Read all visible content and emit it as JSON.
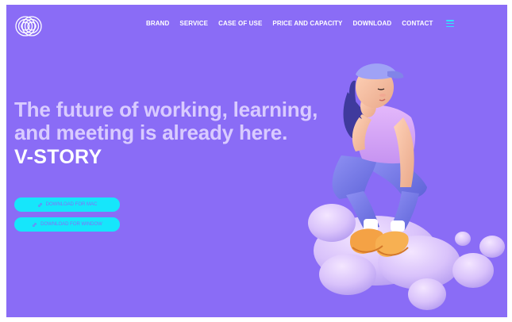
{
  "header": {
    "nav": [
      {
        "label": "BRAND"
      },
      {
        "label": "SERVICE"
      },
      {
        "label": "CASE OF USE"
      },
      {
        "label": "PRICE AND CAPACITY"
      },
      {
        "label": "DOWNLOAD"
      },
      {
        "label": "CONTACT"
      }
    ]
  },
  "hero": {
    "line1": "The future of working, learning,",
    "line2": "and meeting is already here.",
    "brand": "V-STORY"
  },
  "buttons": {
    "download_mac": "DOWNLOAD FOR MAC",
    "download_window": "DOWNLOAD FOR WINDOW"
  },
  "colors": {
    "background": "#8a6cf6",
    "accent": "#16e6fb",
    "hero_text": "#d9cbff"
  },
  "icons": {
    "logo": "interlocking-rings-logo",
    "menu": "hamburger-menu-icon",
    "download": "link-icon"
  }
}
